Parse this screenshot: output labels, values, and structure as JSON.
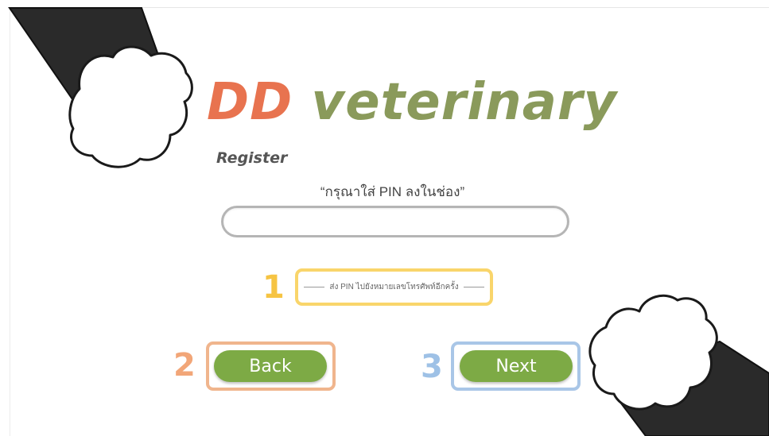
{
  "app": {
    "brand_prefix": "DD",
    "brand_suffix": " veterinary",
    "colors": {
      "brand_green": "#8a9a5b",
      "brand_orange": "#e8734f",
      "button_green": "#7daa45"
    }
  },
  "form": {
    "title": "Register",
    "instruction": "“กรุณาใส่ PIN ลงในช่อง”",
    "pin_value": "",
    "resend_link": "ส่ง PIN ไปยังหมายเลขโทรศัพท์อีกครั้ง"
  },
  "annotations": {
    "marker_1": "1",
    "marker_2": "2",
    "marker_3": "3"
  },
  "buttons": {
    "back_label": "Back",
    "next_label": "Next"
  },
  "decorations": {
    "top_left": "cat-paw-icon",
    "bottom_right": "cat-paw-icon"
  }
}
